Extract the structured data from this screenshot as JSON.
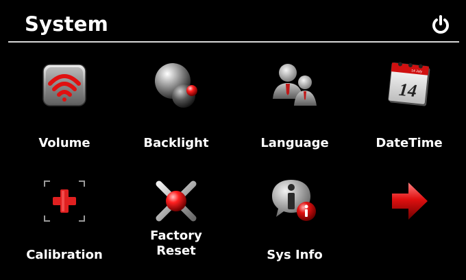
{
  "header": {
    "title": "System",
    "power_icon": "power-icon"
  },
  "tiles": [
    {
      "label": "Volume",
      "icon": "volume-icon",
      "accent": "#e01010"
    },
    {
      "label": "Backlight",
      "icon": "backlight-icon",
      "accent": "#ff2020"
    },
    {
      "label": "Language",
      "icon": "language-icon",
      "accent": "#c01818"
    },
    {
      "label": "DateTime",
      "icon": "calendar-icon",
      "accent": "#d01010",
      "calendar_day": "14",
      "calendar_header": "14 July"
    },
    {
      "label": "Calibration",
      "icon": "calibration-icon",
      "accent": "#e02020"
    },
    {
      "label": "Factory\nReset",
      "icon": "factory-reset-icon",
      "accent": "#ff2020"
    },
    {
      "label": "Sys Info",
      "icon": "sys-info-icon",
      "accent": "#e01010"
    },
    {
      "label": "",
      "icon": "next-arrow-icon",
      "accent": "#e01010"
    }
  ],
  "colors": {
    "background": "#000000",
    "text": "#ffffff",
    "divider": "#d8d8d8",
    "accent": "#e01010"
  }
}
